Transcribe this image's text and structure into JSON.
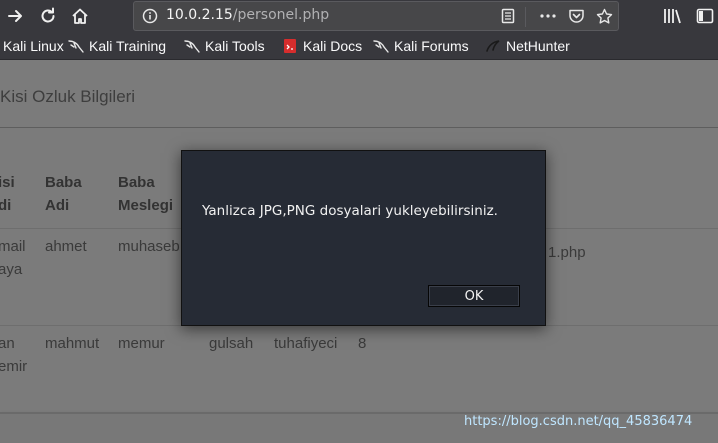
{
  "browser": {
    "url_host": "10.0.2.15",
    "url_path": "/personel.php",
    "icons": [
      "forward-icon",
      "reload-icon",
      "home-icon",
      "info-icon",
      "reader-view-icon",
      "more-icon",
      "pocket-icon",
      "bookmark-star-icon",
      "library-icon",
      "sidebar-icon"
    ]
  },
  "bookmarks": [
    {
      "label": "Kali Linux",
      "icon": "kali-dragon-icon"
    },
    {
      "label": "Kali Training",
      "icon": "kali-dragon-icon"
    },
    {
      "label": "Kali Tools",
      "icon": "kali-dragon-icon"
    },
    {
      "label": "Kali Docs",
      "icon": "kali-docs-icon"
    },
    {
      "label": "Kali Forums",
      "icon": "kali-dragon-icon"
    },
    {
      "label": "NetHunter",
      "icon": "nethunter-icon"
    }
  ],
  "page": {
    "title": "Kisi Ozluk Bilgileri",
    "headers": [
      [
        "isi",
        "di"
      ],
      [
        "Baba",
        "Adi"
      ],
      [
        "Baba",
        "Meslegi"
      ]
    ],
    "rows": [
      {
        "c0": [
          "mail",
          "aya"
        ],
        "c1": "ahmet",
        "c2": "muhaseb",
        "c_file": "1.php"
      },
      {
        "c0": [
          "an",
          "emir"
        ],
        "c1": "mahmut",
        "c2": "memur",
        "c3": "gulsah",
        "c4": "tuhafiyeci",
        "c5": "8"
      }
    ]
  },
  "dialog": {
    "message": "Yanlizca JPG,PNG dosyalari yukleyebilirsiniz.",
    "ok_label": "OK"
  },
  "watermark": "https://blog.csdn.net/qq_45836474",
  "colors": {
    "toolbar_bg": "#38383d",
    "dialog_bg": "#262b35",
    "overlay_page": "#7b7b7b",
    "watermark": "#bfe6ff"
  }
}
